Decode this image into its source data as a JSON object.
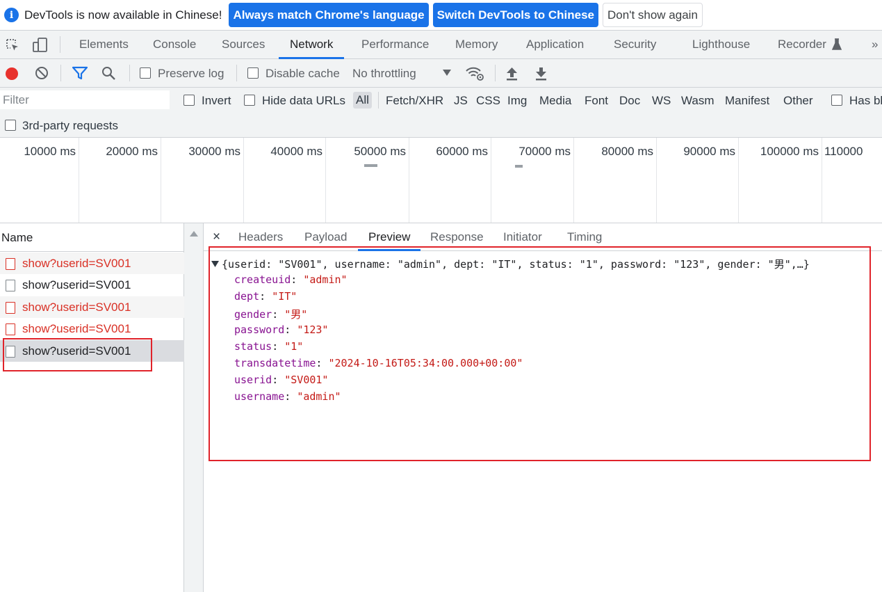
{
  "infobar": {
    "message": "DevTools is now available in Chinese!",
    "match_language": "Always match Chrome's language",
    "switch_language": "Switch DevTools to Chinese",
    "dont_show": "Don't show again"
  },
  "tabs": [
    "Elements",
    "Console",
    "Sources",
    "Network",
    "Performance",
    "Memory",
    "Application",
    "Security",
    "Lighthouse",
    "Recorder"
  ],
  "tabs_overflow": "»",
  "toolbar": {
    "preserve_log": "Preserve log",
    "disable_cache": "Disable cache",
    "throttling": "No throttling"
  },
  "filter": {
    "placeholder": "Filter",
    "invert": "Invert",
    "hide_data_urls": "Hide data URLs",
    "types": [
      "All",
      "Fetch/XHR",
      "JS",
      "CSS",
      "Img",
      "Media",
      "Font",
      "Doc",
      "WS",
      "Wasm",
      "Manifest",
      "Other"
    ],
    "has_blocked": "Has bl",
    "third_party": "3rd-party requests"
  },
  "overview": {
    "ticks": [
      "10000 ms",
      "20000 ms",
      "30000 ms",
      "40000 ms",
      "50000 ms",
      "60000 ms",
      "70000 ms",
      "80000 ms",
      "90000 ms",
      "100000 ms",
      "110000"
    ]
  },
  "request_list": {
    "header": "Name",
    "rows": [
      {
        "name": "show?userid=SV001",
        "error": true
      },
      {
        "name": "show?userid=SV001",
        "error": false
      },
      {
        "name": "show?userid=SV001",
        "error": true
      },
      {
        "name": "show?userid=SV001",
        "error": true
      },
      {
        "name": "show?userid=SV001",
        "error": false,
        "selected": true
      }
    ]
  },
  "detail": {
    "close": "×",
    "tabs": [
      "Headers",
      "Payload",
      "Preview",
      "Response",
      "Initiator",
      "Timing"
    ],
    "active_tab": "Preview",
    "summary": "{userid: \"SV001\", username: \"admin\", dept: \"IT\", status: \"1\", password: \"123\", gender: \"男\",…}",
    "fields": [
      {
        "key": "createuid",
        "value": "\"admin\""
      },
      {
        "key": "dept",
        "value": "\"IT\""
      },
      {
        "key": "gender",
        "value": "\"男\""
      },
      {
        "key": "password",
        "value": "\"123\""
      },
      {
        "key": "status",
        "value": "\"1\""
      },
      {
        "key": "transdatetime",
        "value": "\"2024-10-16T05:34:00.000+00:00\""
      },
      {
        "key": "userid",
        "value": "\"SV001\""
      },
      {
        "key": "username",
        "value": "\"admin\""
      }
    ]
  },
  "colors": {
    "accent": "#1a73e8",
    "error": "#d93025",
    "record": "#e8322d",
    "annotation": "#e0232a"
  }
}
